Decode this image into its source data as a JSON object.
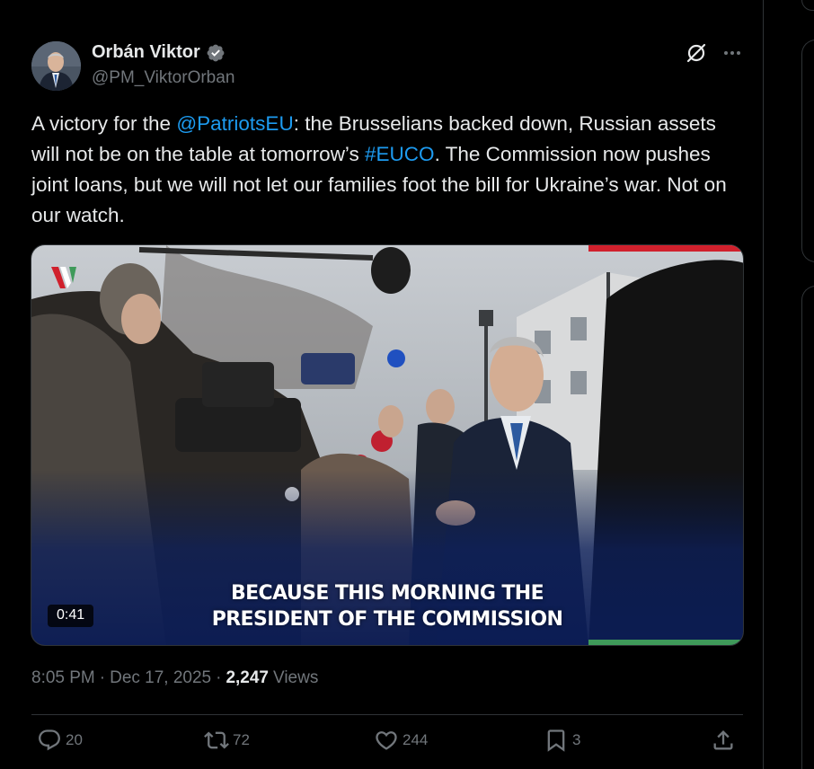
{
  "author": {
    "name": "Orbán Viktor",
    "handle": "@PM_ViktorOrban"
  },
  "tweet": {
    "segments": [
      {
        "text": "A victory for the ",
        "link": false
      },
      {
        "text": "@PatriotsEU",
        "link": true
      },
      {
        "text": ": the Brusselians backed down, Russian assets will not be on the table at tomorrow’s ",
        "link": false
      },
      {
        "text": "#EUCO",
        "link": true
      },
      {
        "text": ". The Commission now pushes joint loans, but we will not let our families foot the bill for Ukraine’s war. Not on our watch.",
        "link": false
      }
    ]
  },
  "media": {
    "caption_line1": "BECAUSE THIS MORNING THE",
    "caption_line2": "PRESIDENT OF THE COMMISSION",
    "duration": "0:41"
  },
  "meta": {
    "time": "8:05 PM",
    "separator": "·",
    "date": "Dec 17, 2025",
    "views_count": "2,247",
    "views_label": "Views"
  },
  "actions": {
    "replies": "20",
    "reposts": "72",
    "likes": "244",
    "bookmarks": "3"
  },
  "icons": {
    "verified": "verified-badge-icon",
    "grok": "grok-icon",
    "more": "more-icon",
    "reply": "reply-icon",
    "repost": "repost-icon",
    "like": "heart-icon",
    "bookmark": "bookmark-icon",
    "share": "share-icon"
  },
  "colors": {
    "accent": "#1d9bf0",
    "text": "#e7e9ea",
    "muted": "#71767b",
    "border": "#2f3336"
  }
}
